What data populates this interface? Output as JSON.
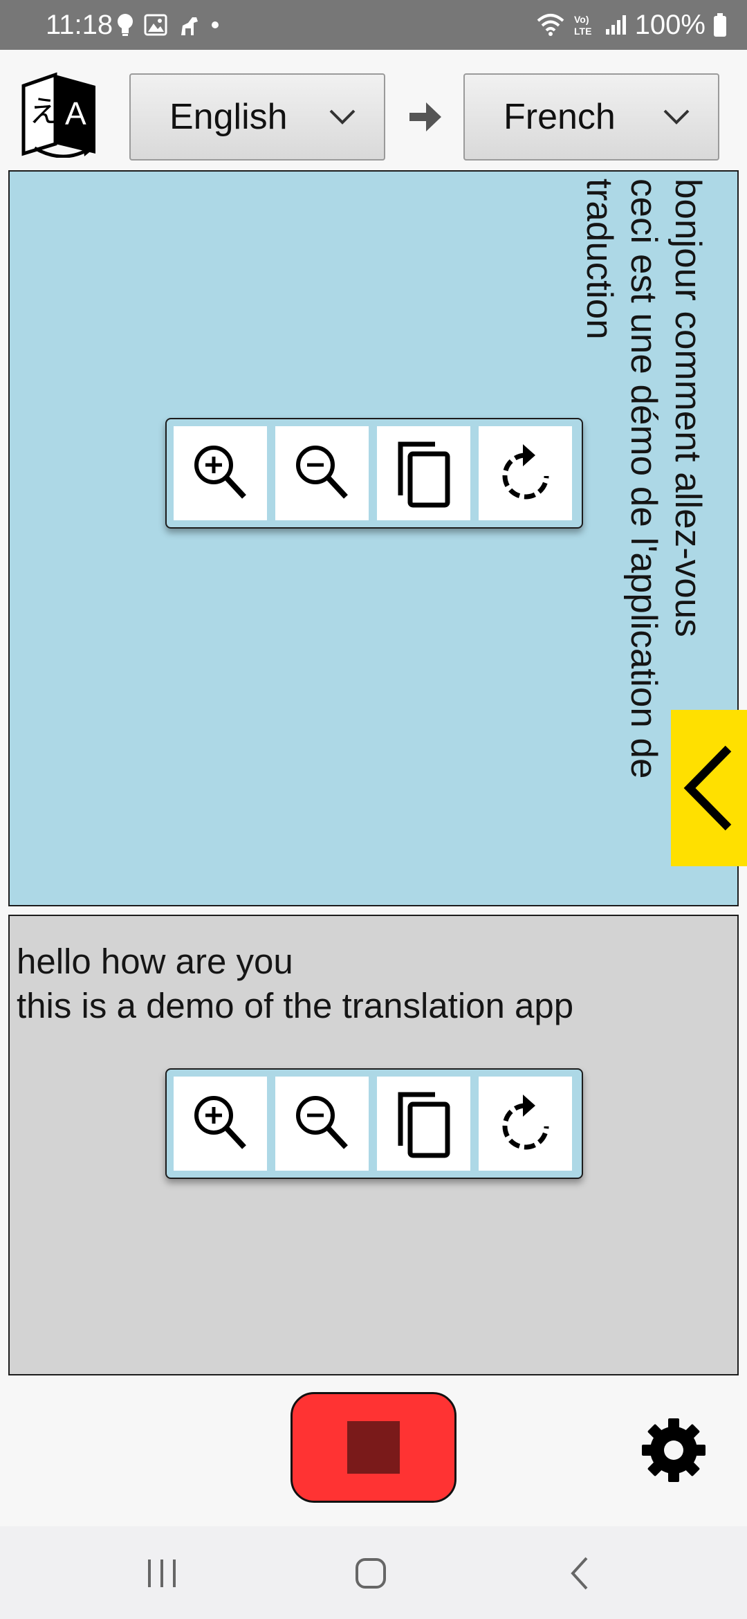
{
  "status_bar": {
    "time": "11:18",
    "battery": "100%",
    "left_icons": [
      "bulb-icon",
      "gallery-icon",
      "dog-icon",
      "dot-icon"
    ],
    "right_icons": [
      "wifi-icon",
      "volte-icon",
      "signal-icon",
      "battery-icon"
    ],
    "volte_label": "Vo) LTE"
  },
  "header": {
    "source_language": "English",
    "target_language": "French"
  },
  "target_panel": {
    "background": "#add8e6",
    "lines": [
      "bonjour comment allez-vous",
      "ceci est une démo de l'application de",
      "traduction"
    ]
  },
  "source_panel": {
    "background": "#d3d3d3",
    "lines": [
      "hello how are you",
      "this is a demo of the translation app"
    ]
  },
  "toolbar_icons": [
    "zoom-in-icon",
    "zoom-out-icon",
    "copy-icon",
    "rotate-icon"
  ],
  "side_tab": {
    "color": "#ffe000",
    "icon": "chevron-left-icon"
  },
  "record_button": {
    "color": "#ff3333",
    "icon": "stop-icon"
  },
  "settings": {
    "icon": "gear-icon"
  },
  "navigation_bar": {
    "icons": [
      "recents-icon",
      "home-icon",
      "back-icon"
    ]
  }
}
